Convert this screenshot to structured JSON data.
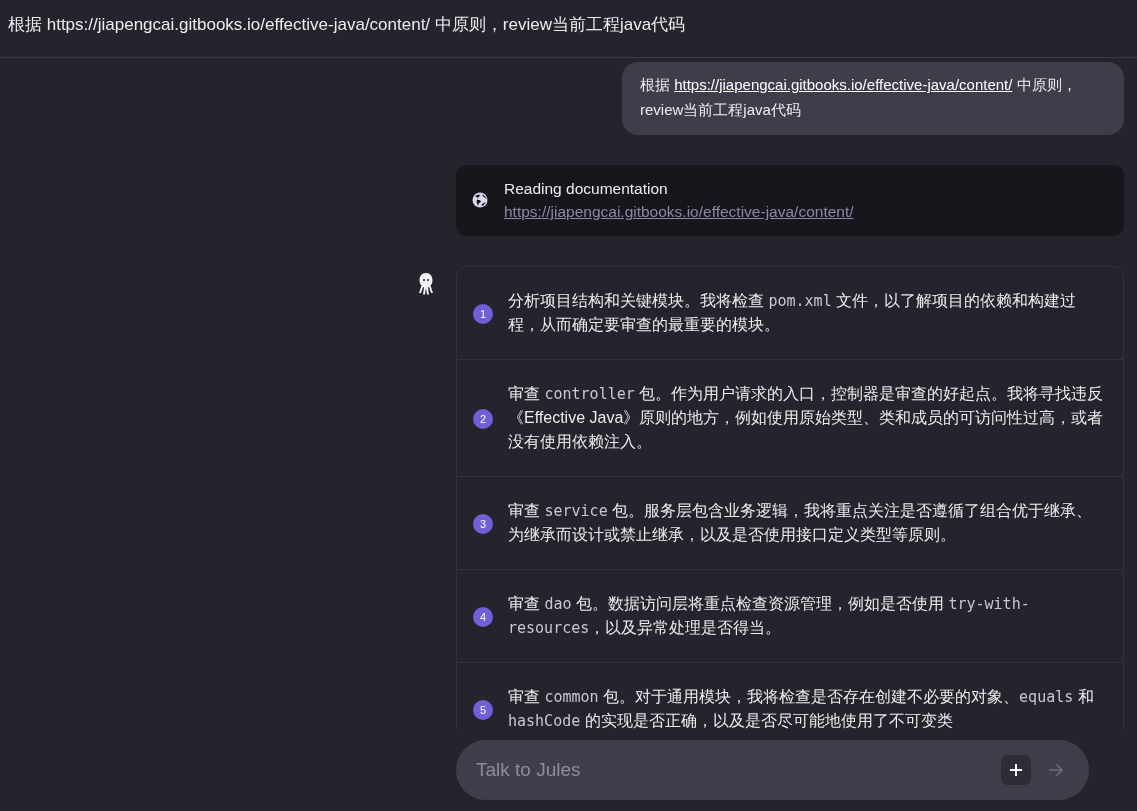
{
  "header": {
    "title": "根据 https://jiapengcai.gitbooks.io/effective-java/content/ 中原则，review当前工程java代码"
  },
  "user_message": {
    "parts": [
      {
        "kind": "text",
        "text": "根据 "
      },
      {
        "kind": "link",
        "text": "https://jiapengcai.gitbooks.io/effective-java/content/"
      },
      {
        "kind": "text",
        "text": " 中原则，review当前工程java代码"
      }
    ]
  },
  "activity": {
    "title": "Reading documentation",
    "link": "https://jiapengcai.gitbooks.io/effective-java/content/"
  },
  "plan": {
    "steps": [
      {
        "number": "1",
        "parts": [
          {
            "kind": "text",
            "text": "分析项目结构和关键模块。我将检查 "
          },
          {
            "kind": "code",
            "text": "pom.xml"
          },
          {
            "kind": "text",
            "text": " 文件，以了解项目的依赖和构建过程，从而确定要审查的最重要的模块。"
          }
        ]
      },
      {
        "number": "2",
        "parts": [
          {
            "kind": "text",
            "text": "审查 "
          },
          {
            "kind": "code",
            "text": "controller"
          },
          {
            "kind": "text",
            "text": " 包。作为用户请求的入口，控制器是审查的好起点。我将寻找违反《Effective Java》原则的地方，例如使用原始类型、类和成员的可访问性过高，或者没有使用依赖注入。"
          }
        ]
      },
      {
        "number": "3",
        "parts": [
          {
            "kind": "text",
            "text": "审查 "
          },
          {
            "kind": "code",
            "text": "service"
          },
          {
            "kind": "text",
            "text": " 包。服务层包含业务逻辑，我将重点关注是否遵循了组合优于继承、为继承而设计或禁止继承，以及是否使用接口定义类型等原则。"
          }
        ]
      },
      {
        "number": "4",
        "parts": [
          {
            "kind": "text",
            "text": "审查 "
          },
          {
            "kind": "code",
            "text": "dao"
          },
          {
            "kind": "text",
            "text": " 包。数据访问层将重点检查资源管理，例如是否使用 "
          },
          {
            "kind": "code",
            "text": "try-with-resources"
          },
          {
            "kind": "text",
            "text": "，以及异常处理是否得当。"
          }
        ]
      },
      {
        "number": "5",
        "parts": [
          {
            "kind": "text",
            "text": "审查 "
          },
          {
            "kind": "code",
            "text": "common"
          },
          {
            "kind": "text",
            "text": " 包。对于通用模块，我将检查是否存在创建不必要的对象、"
          },
          {
            "kind": "code",
            "text": "equals"
          },
          {
            "kind": "text",
            "text": " 和 "
          },
          {
            "kind": "code",
            "text": "hashCode"
          },
          {
            "kind": "text",
            "text": " 的实现是否正确，以及是否尽可能地使用了不可变类"
          }
        ]
      }
    ]
  },
  "composer": {
    "placeholder": "Talk to Jules"
  }
}
